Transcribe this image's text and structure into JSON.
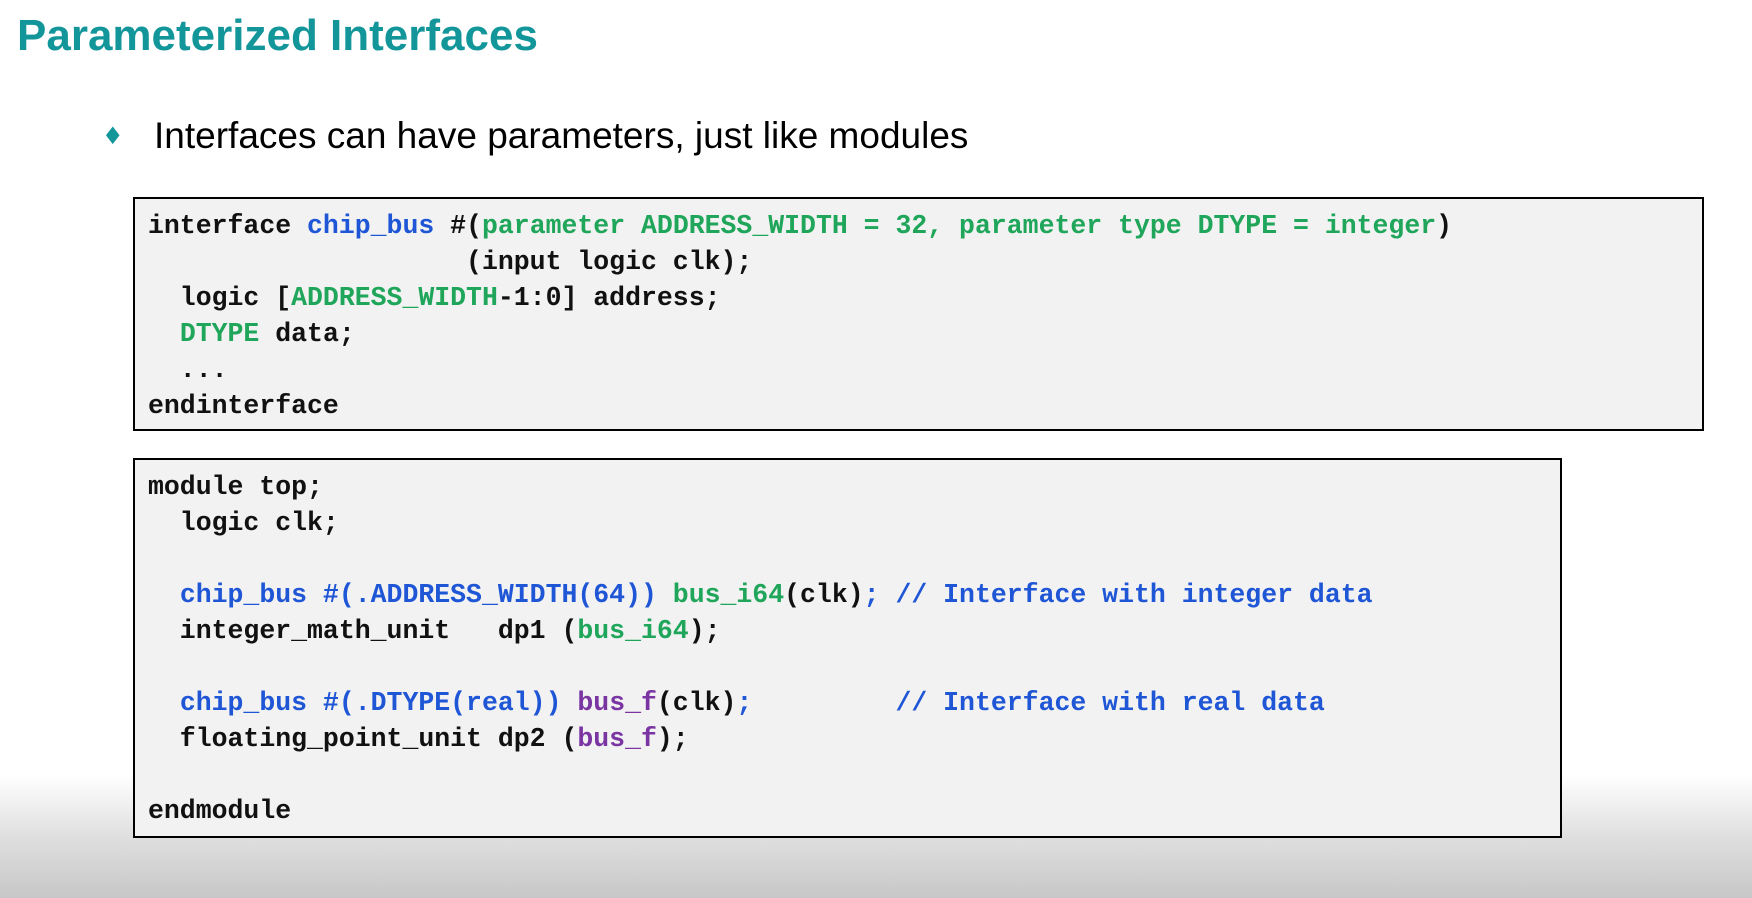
{
  "slide": {
    "title": "Parameterized Interfaces",
    "bullet_glyph": "♦",
    "bullet_text": "Interfaces can have parameters, just like modules"
  },
  "colors": {
    "title": "#12969a",
    "code_background": "#f2f2f2",
    "code_default": "#111111",
    "code_green": "#1fa65a",
    "code_blue": "#1f56d6",
    "code_purple": "#7a35a3"
  },
  "code_interface": [
    [
      {
        "text": "interface ",
        "color": "black"
      },
      {
        "text": "chip_bus",
        "color": "blue"
      },
      {
        "text": " #(",
        "color": "black"
      },
      {
        "text": "parameter ADDRESS_WIDTH = 32, parameter type DTYPE = integer",
        "color": "green"
      },
      {
        "text": ")",
        "color": "black"
      }
    ],
    [
      {
        "text": "                    (input logic clk);",
        "color": "black"
      }
    ],
    [
      {
        "text": "  logic [",
        "color": "black"
      },
      {
        "text": "ADDRESS_WIDTH",
        "color": "green"
      },
      {
        "text": "-1:0] address;",
        "color": "black"
      }
    ],
    [
      {
        "text": "  ",
        "color": "black"
      },
      {
        "text": "DTYPE",
        "color": "green"
      },
      {
        "text": " data;",
        "color": "black"
      }
    ],
    [
      {
        "text": "  ...",
        "color": "black"
      }
    ],
    [
      {
        "text": "endinterface",
        "color": "black"
      }
    ]
  ],
  "code_module": [
    [
      {
        "text": "module top;",
        "color": "black"
      }
    ],
    [
      {
        "text": "  logic clk;",
        "color": "black"
      }
    ],
    [],
    [
      {
        "text": "  ",
        "color": "black"
      },
      {
        "text": "chip_bus #(.ADDRESS_WIDTH(64))",
        "color": "blue"
      },
      {
        "text": " ",
        "color": "black"
      },
      {
        "text": "bus_i64",
        "color": "green"
      },
      {
        "text": "(clk)",
        "color": "black"
      },
      {
        "text": "; // Interface with integer data",
        "color": "blue"
      }
    ],
    [
      {
        "text": "  integer_math_unit   dp1 (",
        "color": "black"
      },
      {
        "text": "bus_i64",
        "color": "green"
      },
      {
        "text": ");",
        "color": "black"
      }
    ],
    [],
    [
      {
        "text": "  ",
        "color": "black"
      },
      {
        "text": "chip_bus #(.DTYPE(real))",
        "color": "blue"
      },
      {
        "text": " ",
        "color": "black"
      },
      {
        "text": "bus_f",
        "color": "purple"
      },
      {
        "text": "(clk)",
        "color": "black"
      },
      {
        "text": ";         // Interface with real data",
        "color": "blue"
      }
    ],
    [
      {
        "text": "  floating_point_unit dp2 (",
        "color": "black"
      },
      {
        "text": "bus_f",
        "color": "purple"
      },
      {
        "text": ");",
        "color": "black"
      }
    ],
    [],
    [
      {
        "text": "endmodule",
        "color": "black"
      }
    ]
  ]
}
